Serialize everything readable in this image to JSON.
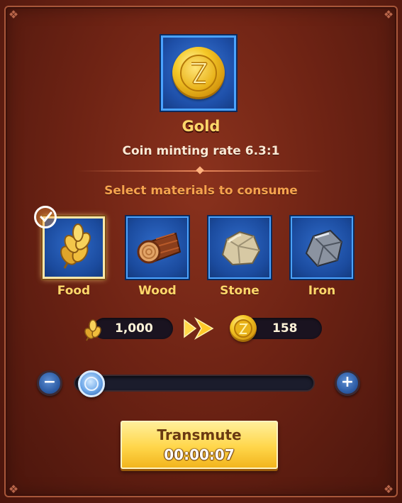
{
  "target": {
    "name": "Gold",
    "rate_text": "Coin minting rate 6.3:1",
    "icon": "gold-coin-icon"
  },
  "section_title": "Select materials to consume",
  "materials": [
    {
      "label": "Food",
      "icon": "wheat-icon",
      "selected": true
    },
    {
      "label": "Wood",
      "icon": "log-icon",
      "selected": false
    },
    {
      "label": "Stone",
      "icon": "stone-icon",
      "selected": false
    },
    {
      "label": "Iron",
      "icon": "iron-ore-icon",
      "selected": false
    }
  ],
  "exchange": {
    "input_amount": "1,000",
    "input_icon": "wheat-icon",
    "output_amount": "158",
    "output_icon": "gold-coin-icon",
    "arrow_icon": "double-arrow-right-icon"
  },
  "slider": {
    "level": 0.0,
    "minus_symbol": "−",
    "plus_symbol": "+"
  },
  "action": {
    "label": "Transmute",
    "timer": "00:00:07"
  },
  "colors": {
    "panel_bg": "#6e2314",
    "accent_gold": "#ffd76a",
    "slot_blue": "#1b4b9e",
    "slot_border": "#4aa3ff",
    "button_yellow": "#ffd64a"
  }
}
